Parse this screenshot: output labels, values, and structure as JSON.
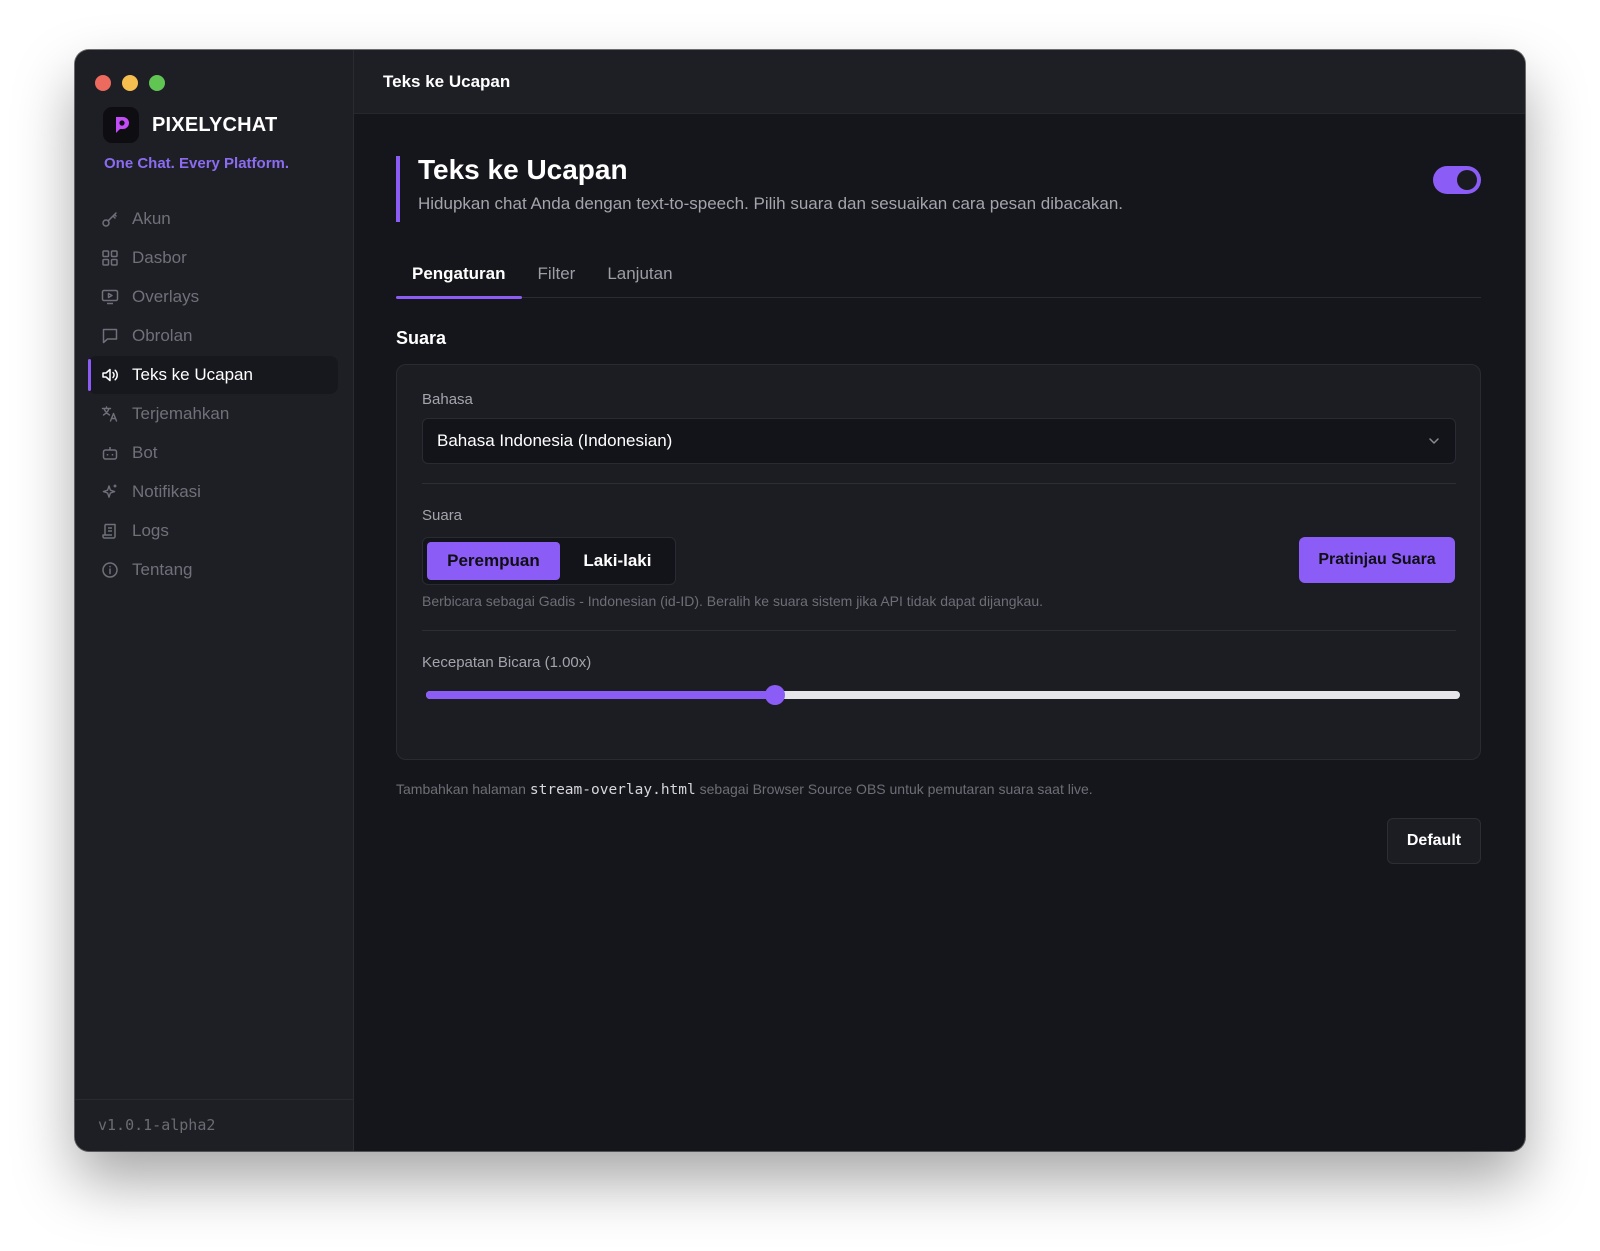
{
  "app": {
    "brand": "PIXELYCHAT",
    "tagline": "One Chat. Every Platform.",
    "version": "v1.0.1-alpha2",
    "accent_color": "#8b5cf6"
  },
  "sidebar": {
    "items": [
      {
        "label": "Akun",
        "icon": "key-icon",
        "active": false
      },
      {
        "label": "Dasbor",
        "icon": "grid-icon",
        "active": false
      },
      {
        "label": "Overlays",
        "icon": "monitor-play-icon",
        "active": false
      },
      {
        "label": "Obrolan",
        "icon": "chat-bubble-icon",
        "active": false
      },
      {
        "label": "Teks ke Ucapan",
        "icon": "speaker-icon",
        "active": true
      },
      {
        "label": "Terjemahkan",
        "icon": "translate-icon",
        "active": false
      },
      {
        "label": "Bot",
        "icon": "robot-icon",
        "active": false
      },
      {
        "label": "Notifikasi",
        "icon": "sparkle-icon",
        "active": false
      },
      {
        "label": "Logs",
        "icon": "scroll-icon",
        "active": false
      },
      {
        "label": "Tentang",
        "icon": "info-icon",
        "active": false
      }
    ]
  },
  "topbar": {
    "title": "Teks ke Ucapan"
  },
  "page": {
    "title": "Teks ke Ucapan",
    "subtitle": "Hidupkan chat Anda dengan text-to-speech. Pilih suara dan sesuaikan cara pesan dibacakan.",
    "enabled": true
  },
  "tabs": [
    {
      "label": "Pengaturan",
      "active": true
    },
    {
      "label": "Filter",
      "active": false
    },
    {
      "label": "Lanjutan",
      "active": false
    }
  ],
  "voice_section": {
    "title": "Suara",
    "language_label": "Bahasa",
    "language_value": "Bahasa Indonesia (Indonesian)",
    "voice_label": "Suara",
    "voice_options": [
      "Perempuan",
      "Laki-laki"
    ],
    "voice_selected": "Perempuan",
    "preview_button": "Pratinjau Suara",
    "hint": "Berbicara sebagai Gadis - Indonesian (id-ID). Beralih ke suara sistem jika API tidak dapat dijangkau.",
    "speed_label": "Kecepatan Bicara (1.00x)",
    "speed_fraction": 0.338
  },
  "footer": {
    "note_prefix": "Tambahkan halaman ",
    "note_code": "stream-overlay.html",
    "note_suffix": " sebagai Browser Source OBS untuk pemutaran suara saat live.",
    "default_button": "Default"
  }
}
